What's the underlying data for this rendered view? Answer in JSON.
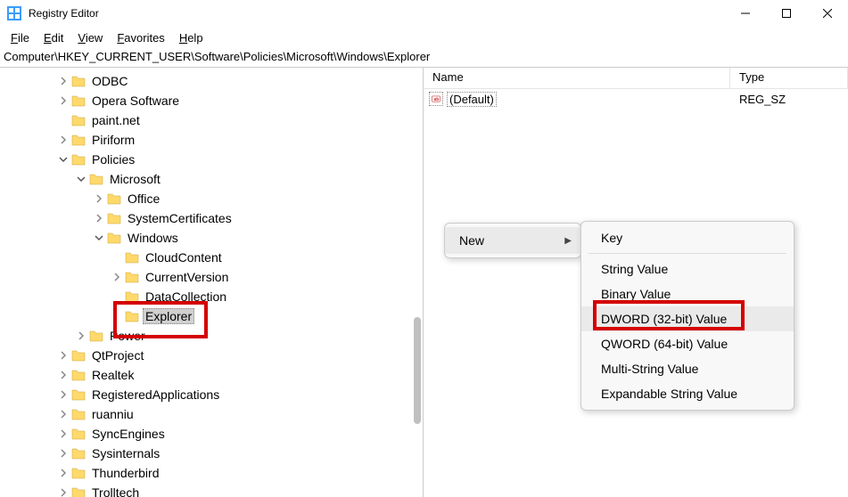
{
  "window": {
    "title": "Registry Editor"
  },
  "menu": {
    "file": "File",
    "edit": "Edit",
    "view": "View",
    "favorites": "Favorites",
    "help": "Help"
  },
  "address": "Computer\\HKEY_CURRENT_USER\\Software\\Policies\\Microsoft\\Windows\\Explorer",
  "tree": {
    "items": [
      {
        "indent": 60,
        "chev": ">",
        "label": "ODBC"
      },
      {
        "indent": 60,
        "chev": ">",
        "label": "Opera Software"
      },
      {
        "indent": 60,
        "chev": "",
        "label": "paint.net"
      },
      {
        "indent": 60,
        "chev": ">",
        "label": "Piriform"
      },
      {
        "indent": 60,
        "chev": "v",
        "label": "Policies"
      },
      {
        "indent": 80,
        "chev": "v",
        "label": "Microsoft"
      },
      {
        "indent": 100,
        "chev": ">",
        "label": "Office"
      },
      {
        "indent": 100,
        "chev": ">",
        "label": "SystemCertificates"
      },
      {
        "indent": 100,
        "chev": "v",
        "label": "Windows"
      },
      {
        "indent": 120,
        "chev": "",
        "label": "CloudContent"
      },
      {
        "indent": 120,
        "chev": ">",
        "label": "CurrentVersion"
      },
      {
        "indent": 120,
        "chev": "",
        "label": "DataCollection"
      },
      {
        "indent": 120,
        "chev": "",
        "label": "Explorer",
        "selected": true
      },
      {
        "indent": 80,
        "chev": ">",
        "label": "Power"
      },
      {
        "indent": 60,
        "chev": ">",
        "label": "QtProject"
      },
      {
        "indent": 60,
        "chev": ">",
        "label": "Realtek"
      },
      {
        "indent": 60,
        "chev": ">",
        "label": "RegisteredApplications"
      },
      {
        "indent": 60,
        "chev": ">",
        "label": "ruanniu"
      },
      {
        "indent": 60,
        "chev": ">",
        "label": "SyncEngines"
      },
      {
        "indent": 60,
        "chev": ">",
        "label": "Sysinternals"
      },
      {
        "indent": 60,
        "chev": ">",
        "label": "Thunderbird"
      },
      {
        "indent": 60,
        "chev": ">",
        "label": "Trolltech"
      }
    ]
  },
  "list": {
    "headers": {
      "name": "Name",
      "type": "Type"
    },
    "rows": [
      {
        "name": "(Default)",
        "type": "REG_SZ"
      }
    ]
  },
  "context": {
    "new": "New",
    "sub": {
      "key": "Key",
      "string": "String Value",
      "binary": "Binary Value",
      "dword": "DWORD (32-bit) Value",
      "qword": "QWORD (64-bit) Value",
      "multi": "Multi-String Value",
      "expand": "Expandable String Value"
    }
  }
}
